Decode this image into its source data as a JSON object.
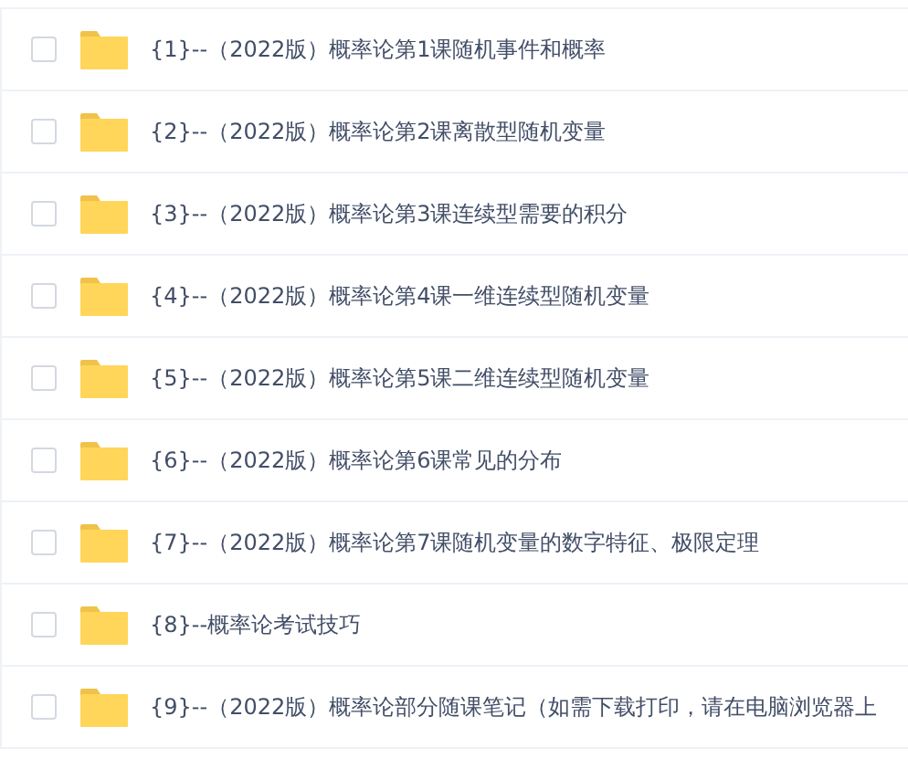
{
  "files": [
    {
      "name": "{1}--（2022版）概率论第1课随机事件和概率",
      "checked": false
    },
    {
      "name": "{2}--（2022版）概率论第2课离散型随机变量",
      "checked": false
    },
    {
      "name": "{3}--（2022版）概率论第3课连续型需要的积分",
      "checked": false
    },
    {
      "name": "{4}--（2022版）概率论第4课一维连续型随机变量",
      "checked": false
    },
    {
      "name": "{5}--（2022版）概率论第5课二维连续型随机变量",
      "checked": false
    },
    {
      "name": "{6}--（2022版）概率论第6课常见的分布",
      "checked": false
    },
    {
      "name": "{7}--（2022版）概率论第7课随机变量的数字特征、极限定理",
      "checked": false
    },
    {
      "name": "{8}--概率论考试技巧",
      "checked": false
    },
    {
      "name": "{9}--（2022版）概率论部分随课笔记（如需下载打印，请在电脑浏览器上",
      "checked": false
    }
  ]
}
